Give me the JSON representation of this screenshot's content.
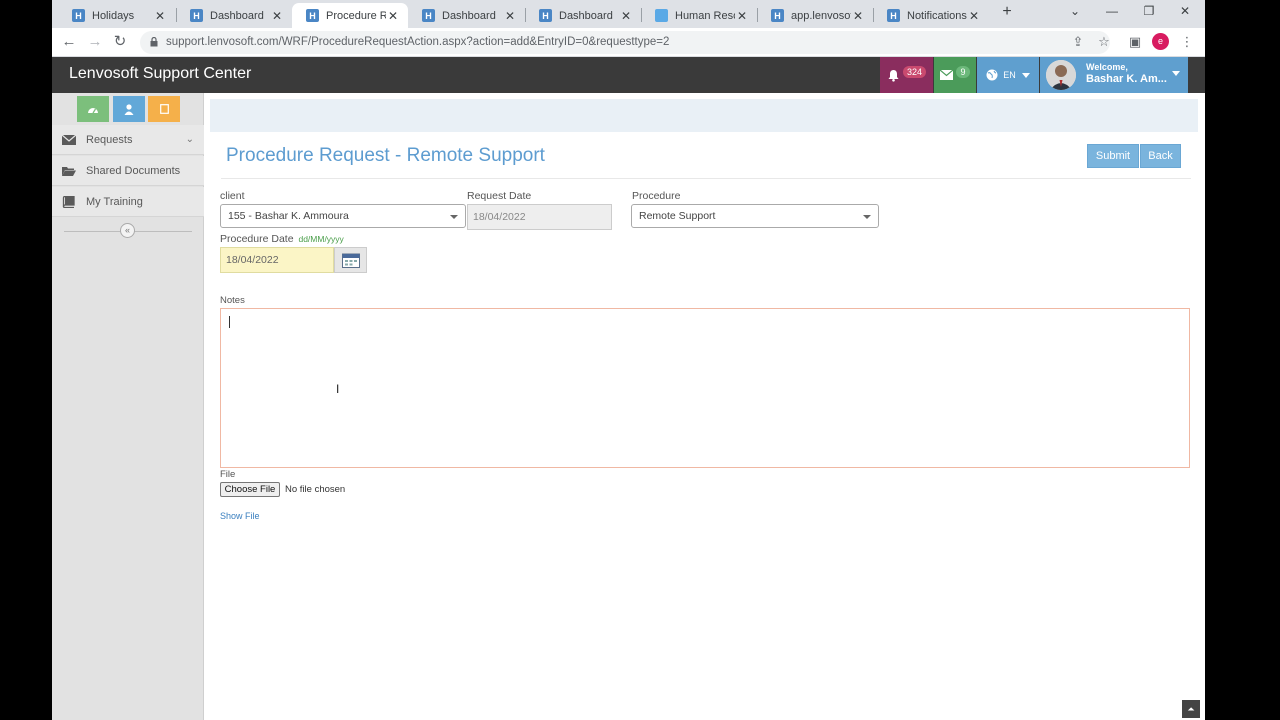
{
  "browser": {
    "tabs": [
      {
        "label": "Holidays",
        "active": false
      },
      {
        "label": "Dashboard",
        "active": false
      },
      {
        "label": "Procedure Req",
        "active": true
      },
      {
        "label": "Dashboard",
        "active": false
      },
      {
        "label": "Dashboard",
        "active": false
      },
      {
        "label": "Human Resour",
        "active": false
      },
      {
        "label": "app.lenvosoft.c",
        "active": false
      },
      {
        "label": "Notifications Te",
        "active": false
      }
    ],
    "url": "support.lenvosoft.com/WRF/ProcedureRequestAction.aspx?action=add&EntryID=0&requesttype=2",
    "profile_initial": "e"
  },
  "header": {
    "app_title": "Lenvosoft Support Center",
    "notifications_count": "324",
    "messages_count": "9",
    "language": "EN",
    "welcome_label": "Welcome,",
    "user_name": "Bashar K. Am..."
  },
  "sidebar": {
    "items": [
      {
        "label": "Requests",
        "icon": "envelope-icon"
      },
      {
        "label": "Shared Documents",
        "icon": "folder-open-icon"
      },
      {
        "label": "My Training",
        "icon": "book-icon"
      }
    ],
    "collapse_symbol": "«"
  },
  "page": {
    "title": "Procedure Request - Remote Support",
    "submit_label": "Submit",
    "back_label": "Back"
  },
  "form": {
    "client_label": "client",
    "client_value": "155 - Bashar K. Ammoura",
    "request_date_label": "Request Date",
    "request_date_value": "18/04/2022",
    "procedure_label": "Procedure",
    "procedure_value": "Remote Support",
    "procedure_date_label": "Procedure Date",
    "procedure_date_format": "dd/MM/yyyy",
    "procedure_date_value": "18/04/2022",
    "notes_label": "Notes",
    "notes_value": "",
    "file_label": "File",
    "choose_file_label": "Choose File",
    "no_file_text": "No file chosen",
    "show_file_label": "Show File"
  }
}
